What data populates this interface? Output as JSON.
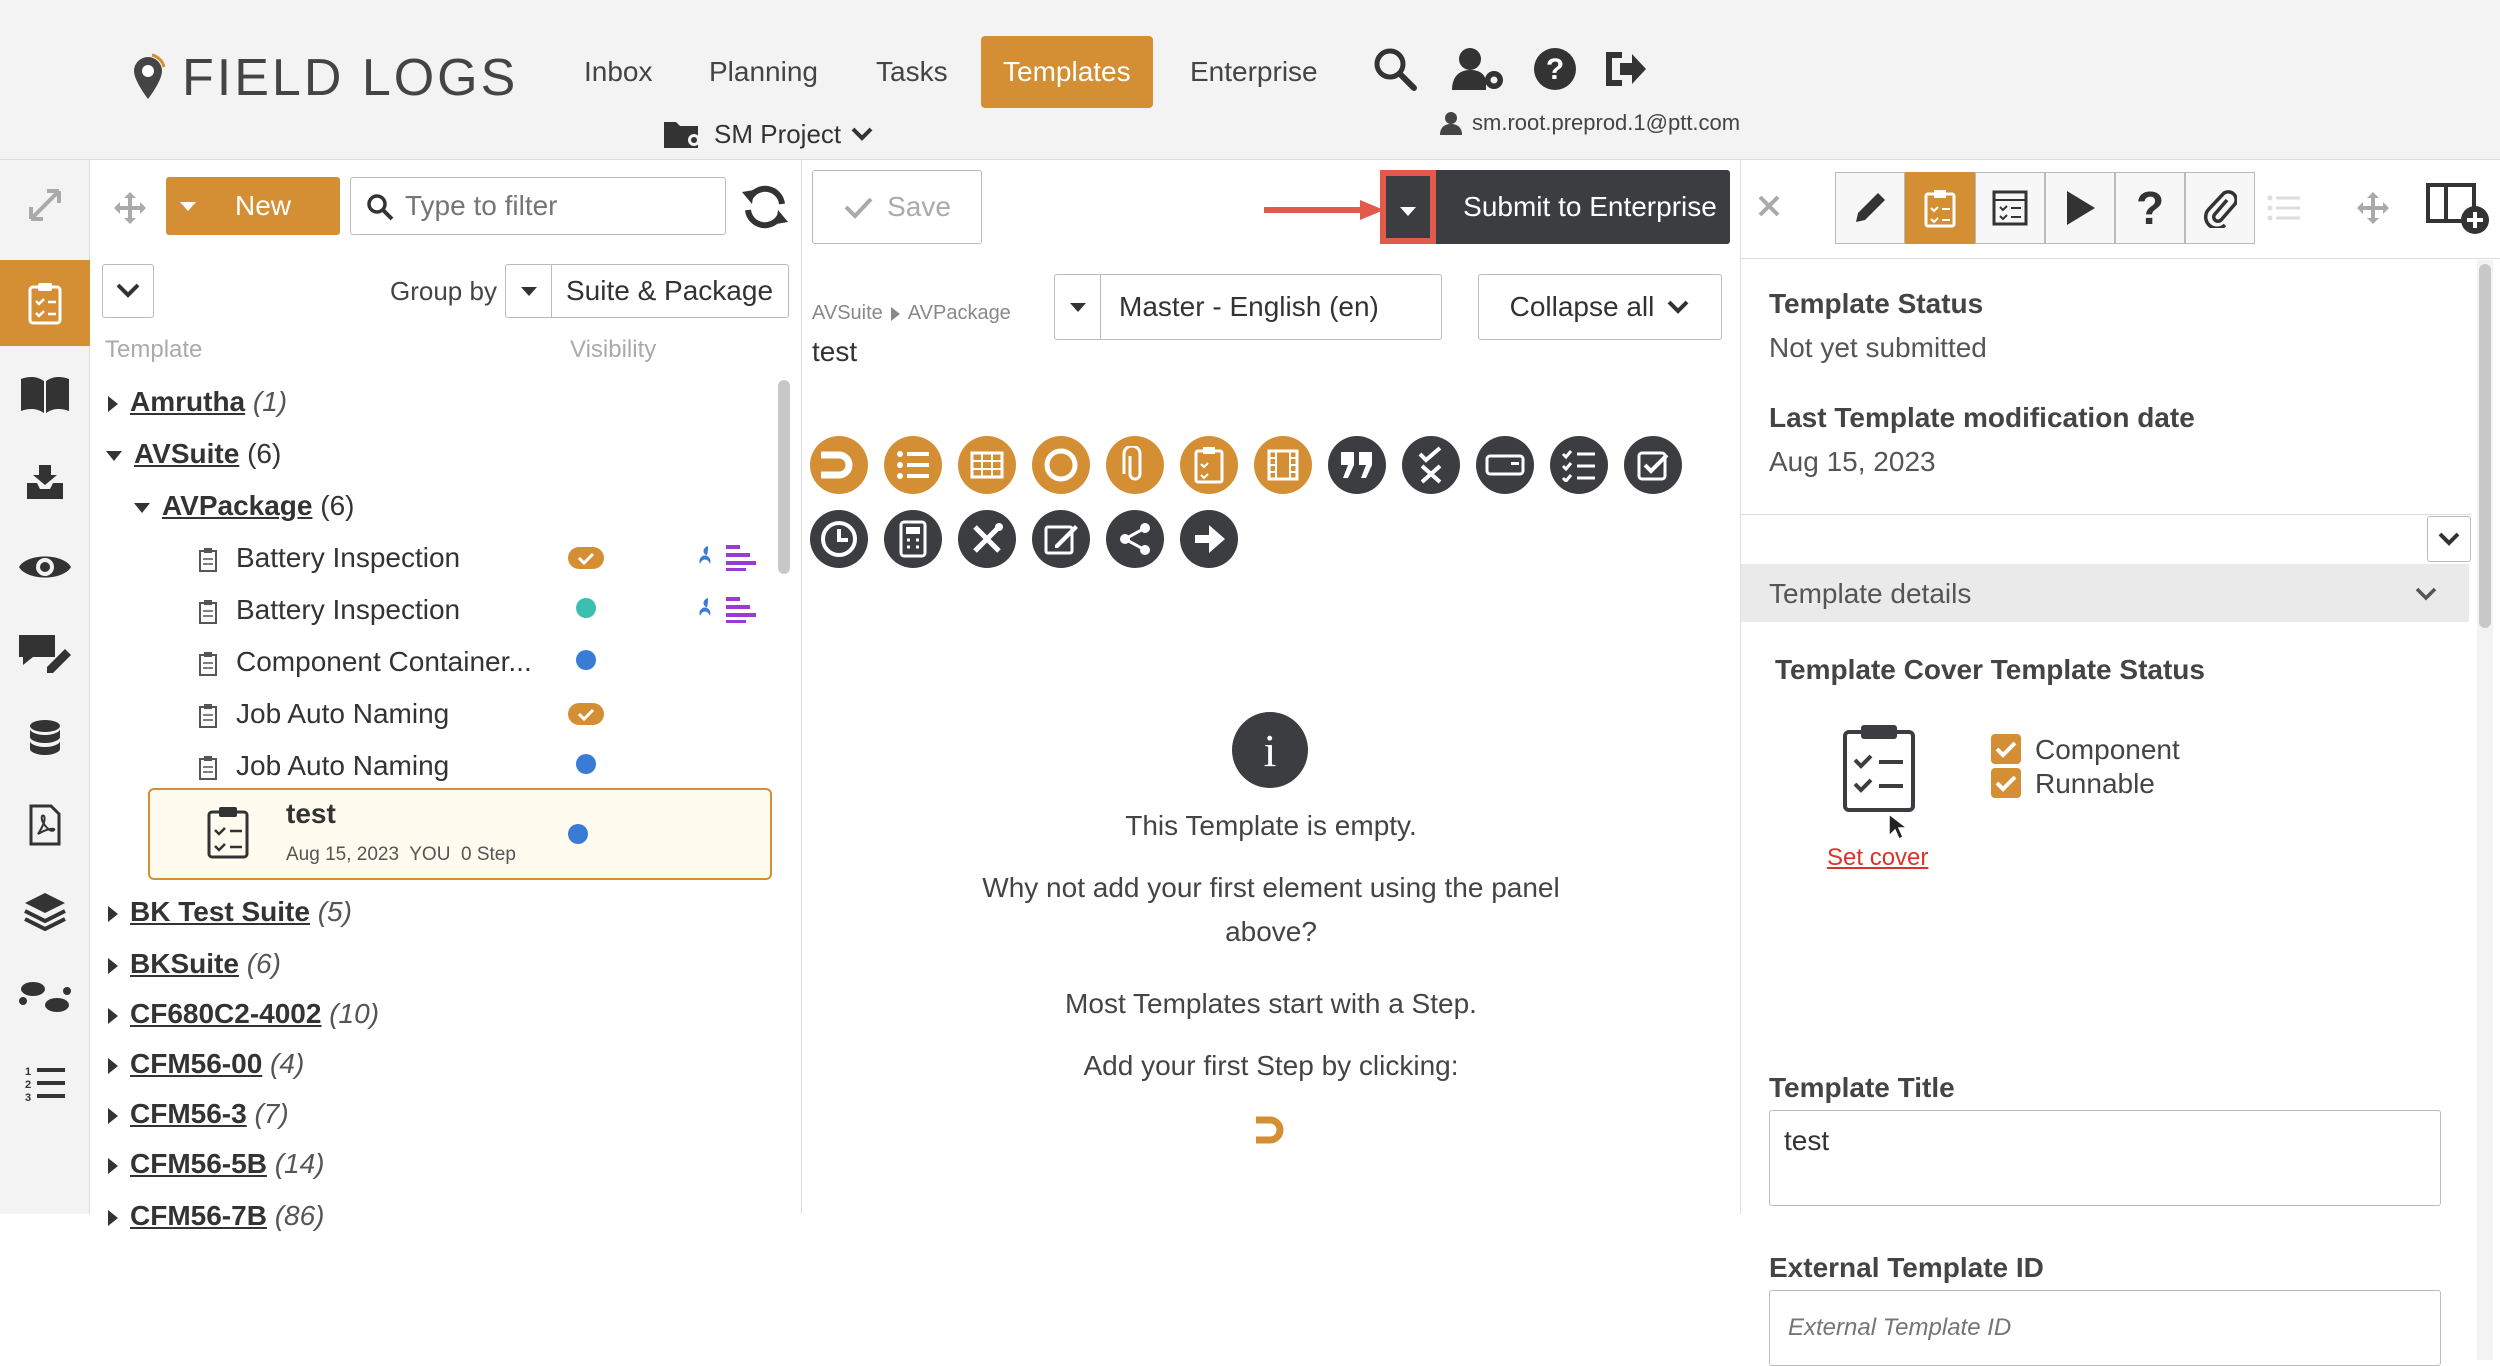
{
  "header": {
    "brand": "FIELD LOGS",
    "nav": [
      "Inbox",
      "Planning",
      "Tasks",
      "Templates",
      "Enterprise"
    ],
    "project": "SM Project",
    "user_email": "sm.root.preprod.1@ptt.com"
  },
  "tree": {
    "new_label": "New",
    "filter_placeholder": "Type to filter",
    "group_by_label": "Group by",
    "group_by_value": "Suite & Package",
    "col_template": "Template",
    "col_visibility": "Visibility",
    "suites": [
      {
        "name": "Amrutha",
        "count": "(1)"
      },
      {
        "name": "AVSuite",
        "count": "(6)"
      },
      {
        "name": "BK Test Suite",
        "count": "(5)"
      },
      {
        "name": "BKSuite",
        "count": "(6)"
      },
      {
        "name": "CF680C2-4002",
        "count": "(10)"
      },
      {
        "name": "CFM56-00",
        "count": "(4)"
      },
      {
        "name": "CFM56-3",
        "count": "(7)"
      },
      {
        "name": "CFM56-5B",
        "count": "(14)"
      },
      {
        "name": "CFM56-7B",
        "count": "(86)"
      }
    ],
    "package": {
      "name": "AVPackage",
      "count": "(6)"
    },
    "templates": [
      {
        "name": "Battery Inspection"
      },
      {
        "name": "Battery Inspection"
      },
      {
        "name": "Component Container..."
      },
      {
        "name": "Job Auto Naming"
      },
      {
        "name": "Job Auto Naming"
      }
    ],
    "selected": {
      "name": "test",
      "meta": "Aug 15, 2023  YOU  0 Step"
    }
  },
  "editor": {
    "save_label": "Save",
    "submit_label": "Submit to Enterprise",
    "breadcrumb_suite": "AVSuite",
    "breadcrumb_package": "AVPackage",
    "template_name": "test",
    "language": "Master - English (en)",
    "collapse_label": "Collapse all",
    "empty_title": "This Template is empty.",
    "empty_line1": "Why not add your first element using the panel",
    "empty_line2": "above?",
    "empty_line3": "Most Templates start with a Step.",
    "empty_line4": "Add your first Step by clicking:"
  },
  "details": {
    "status_label": "Template Status",
    "status_value": "Not yet submitted",
    "mod_label": "Last Template modification date",
    "mod_value": "Aug 15, 2023",
    "section_title": "Template details",
    "cover_label": "Template Cover",
    "status_heading": "Template Status",
    "opt_component": "Component",
    "opt_runnable": "Runnable",
    "set_cover": "Set cover",
    "title_label": "Template Title",
    "title_value": "test",
    "ext_label": "External Template ID",
    "ext_placeholder": "External Template ID"
  },
  "colors": {
    "accent": "#d48f35",
    "dark": "#3b3d40",
    "teal": "#3cbfae",
    "blue": "#3a7bd5",
    "link_red": "#d9342b"
  }
}
